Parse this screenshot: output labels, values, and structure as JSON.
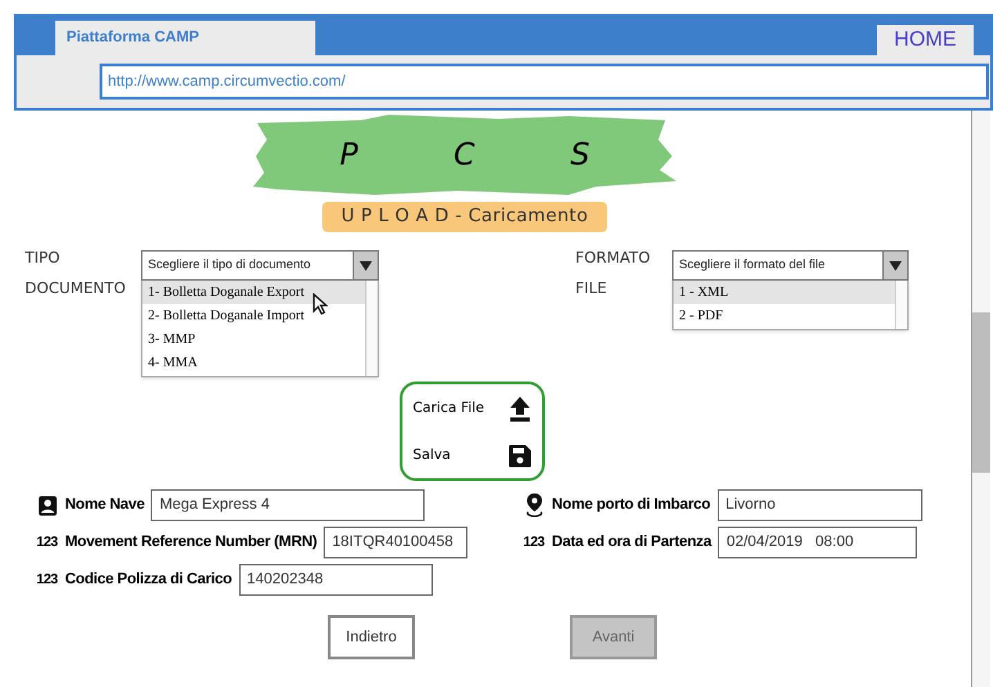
{
  "browser": {
    "tab_title": "Piattaforma CAMP",
    "home_tab": "HOME",
    "url": "http://www.camp.circumvectio.com/"
  },
  "banner": {
    "letters": [
      "P",
      "C",
      "S"
    ],
    "subtitle": "U P L O A D - Caricamento"
  },
  "tipo_documento": {
    "label_lines": [
      "TIPO",
      "DOCUMENTO"
    ],
    "placeholder": "Scegliere il tipo di documento",
    "options": [
      {
        "label": "1- Bolletta Doganale Export",
        "selected": true
      },
      {
        "label": "2- Bolletta Doganale Import",
        "selected": false
      },
      {
        "label": "3- MMP",
        "selected": false
      },
      {
        "label": "4- MMA",
        "selected": false
      }
    ]
  },
  "formato_file": {
    "label_lines": [
      "FORMATO",
      "FILE"
    ],
    "placeholder": "Scegliere il formato del file",
    "options": [
      {
        "label": "1 - XML",
        "selected": true
      },
      {
        "label": "2 - PDF",
        "selected": false
      }
    ]
  },
  "actions": [
    {
      "kind": "upload",
      "label": "Carica File"
    },
    {
      "kind": "save",
      "label": "Salva"
    }
  ],
  "fields_left": [
    {
      "kind": "person",
      "label": "Nome Nave",
      "value": "Mega Express 4"
    },
    {
      "kind": "number",
      "icon_text": "123",
      "label": "Movement Reference Number (MRN)",
      "value": "18ITQR40100458"
    },
    {
      "kind": "number",
      "icon_text": "123",
      "label": "Codice Polizza di Carico",
      "value": "140202348"
    }
  ],
  "fields_right": [
    {
      "kind": "location",
      "label": "Nome porto di Imbarco",
      "value": "Livorno"
    },
    {
      "kind": "number",
      "icon_text": "123",
      "label": "Data ed ora di Partenza",
      "value": "02/04/2019   08:00"
    }
  ],
  "buttons": [
    {
      "label": "Indietro",
      "disabled": false
    },
    {
      "label": "Avanti",
      "disabled": true
    }
  ]
}
